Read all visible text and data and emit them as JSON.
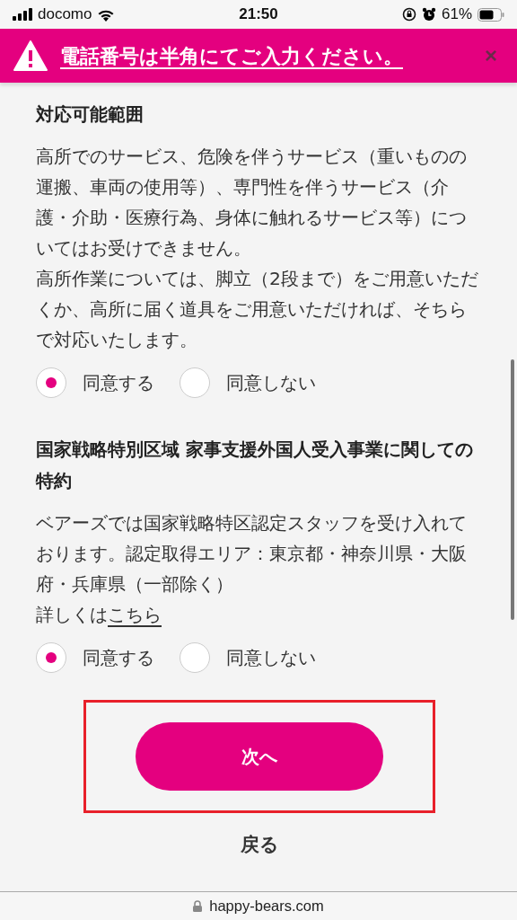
{
  "status_bar": {
    "carrier": "docomo",
    "time": "21:50",
    "battery": "61%"
  },
  "alert": {
    "message": "電話番号は半角にてご入力ください。",
    "close": "×"
  },
  "sections": [
    {
      "title": "対応可能範囲",
      "paragraphs": [
        "高所でのサービス、危険を伴うサービス（重いものの運搬、車両の使用等）、専門性を伴うサービス（介護・介助・医療行為、身体に触れるサービス等）についてはお受けできません。",
        "高所作業については、脚立（2段まで）をご用意いただくか、高所に届く道具をご用意いただければ、そちらで対応いたします。"
      ],
      "options": [
        {
          "label": "同意する",
          "selected": true
        },
        {
          "label": "同意しない",
          "selected": false
        }
      ]
    },
    {
      "title": "国家戦略特別区域 家事支援外国人受入事業に関しての特約",
      "paragraphs": [
        "ベアーズでは国家戦略特区認定スタッフを受け入れております。認定取得エリア：東京都・神奈川県・大阪府・兵庫県（一部除く）"
      ],
      "more": {
        "prefix": "詳しくは",
        "link": "こちら"
      },
      "options": [
        {
          "label": "同意する",
          "selected": true
        },
        {
          "label": "同意しない",
          "selected": false
        }
      ]
    }
  ],
  "next_button": "次へ",
  "back_link": "戻る",
  "url": "happy-bears.com"
}
